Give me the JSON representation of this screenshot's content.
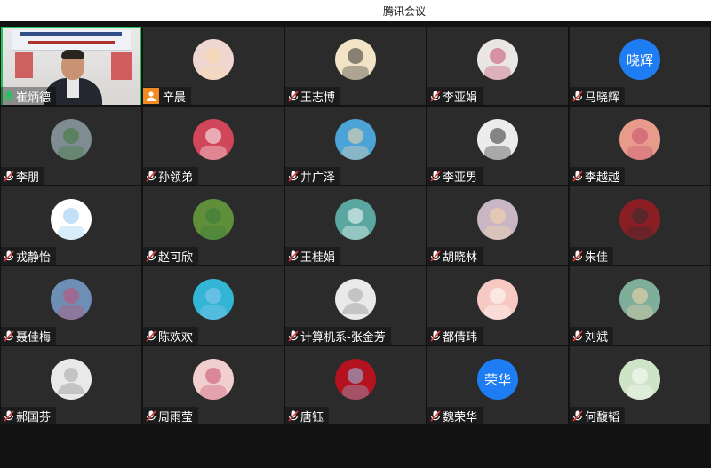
{
  "window": {
    "title": "腾讯会议"
  },
  "participants": [
    {
      "name": "崔炳德",
      "avatar": "video",
      "mic": "green",
      "bg": "#ffffff"
    },
    {
      "name": "辛晨",
      "avatar": "baby-photo",
      "mic": "host",
      "bg": "#f0d6d0"
    },
    {
      "name": "王志博",
      "avatar": "calligraphy-photo",
      "mic": "muted",
      "bg": "#f2e3c6"
    },
    {
      "name": "李亚娟",
      "avatar": "girl-photo",
      "mic": "muted",
      "bg": "#e9e6e3"
    },
    {
      "name": "马晓辉",
      "avatar": "text",
      "avatar_text": "晓辉",
      "mic": "muted",
      "bg": "#1e7df2"
    },
    {
      "name": "李朋",
      "avatar": "sea-photo",
      "mic": "muted",
      "bg": "#7f8c91"
    },
    {
      "name": "孙领弟",
      "avatar": "flowers-photo",
      "mic": "muted",
      "bg": "#d0465a"
    },
    {
      "name": "井广泽",
      "avatar": "cartoon-photo",
      "mic": "muted",
      "bg": "#4ba3d8"
    },
    {
      "name": "李亚男",
      "avatar": "portrait-photo",
      "mic": "muted",
      "bg": "#ececec"
    },
    {
      "name": "李越越",
      "avatar": "illustration-photo",
      "mic": "muted",
      "bg": "#e79b8b"
    },
    {
      "name": "戎静怡",
      "avatar": "white-logo",
      "mic": "muted",
      "bg": "#ffffff"
    },
    {
      "name": "赵可欣",
      "avatar": "tree-photo",
      "mic": "muted",
      "bg": "#5f8f3b"
    },
    {
      "name": "王桂娟",
      "avatar": "lotus-photo",
      "mic": "muted",
      "bg": "#5aa6a0"
    },
    {
      "name": "胡晓林",
      "avatar": "dancer-photo",
      "mic": "muted",
      "bg": "#c9b6c4"
    },
    {
      "name": "朱佳",
      "avatar": "bowl-photo",
      "mic": "muted",
      "bg": "#8b1e22"
    },
    {
      "name": "聂佳梅",
      "avatar": "landscape-photo",
      "mic": "muted",
      "bg": "#6d8fb6"
    },
    {
      "name": "陈欢欢",
      "avatar": "beach-photo",
      "mic": "muted",
      "bg": "#33b6d6"
    },
    {
      "name": "计算机系-张金芳",
      "avatar": "default",
      "mic": "muted",
      "bg": "#e9e9e9"
    },
    {
      "name": "都倩玮",
      "avatar": "pig-photo",
      "mic": "muted",
      "bg": "#f6c9c3"
    },
    {
      "name": "刘斌",
      "avatar": "mountain-photo",
      "mic": "muted",
      "bg": "#7fae9a"
    },
    {
      "name": "郝国芬",
      "avatar": "default",
      "mic": "muted",
      "bg": "#e9e9e9"
    },
    {
      "name": "周雨莹",
      "avatar": "shinchan-photo",
      "mic": "muted",
      "bg": "#f2cfcf"
    },
    {
      "name": "唐钰",
      "avatar": "red-photo",
      "mic": "muted",
      "bg": "#b3121e"
    },
    {
      "name": "魏荣华",
      "avatar": "text",
      "avatar_text": "荣华",
      "mic": "muted",
      "bg": "#1e7df2"
    },
    {
      "name": "何馥韬",
      "avatar": "panda-photo",
      "mic": "muted",
      "bg": "#cfe3c7"
    }
  ],
  "colors": {
    "accent": "#19c95b",
    "tile": "#2b2b2b",
    "background": "#121212",
    "host_badge": "#f28a23",
    "text_avatar": "#1e7df2"
  }
}
